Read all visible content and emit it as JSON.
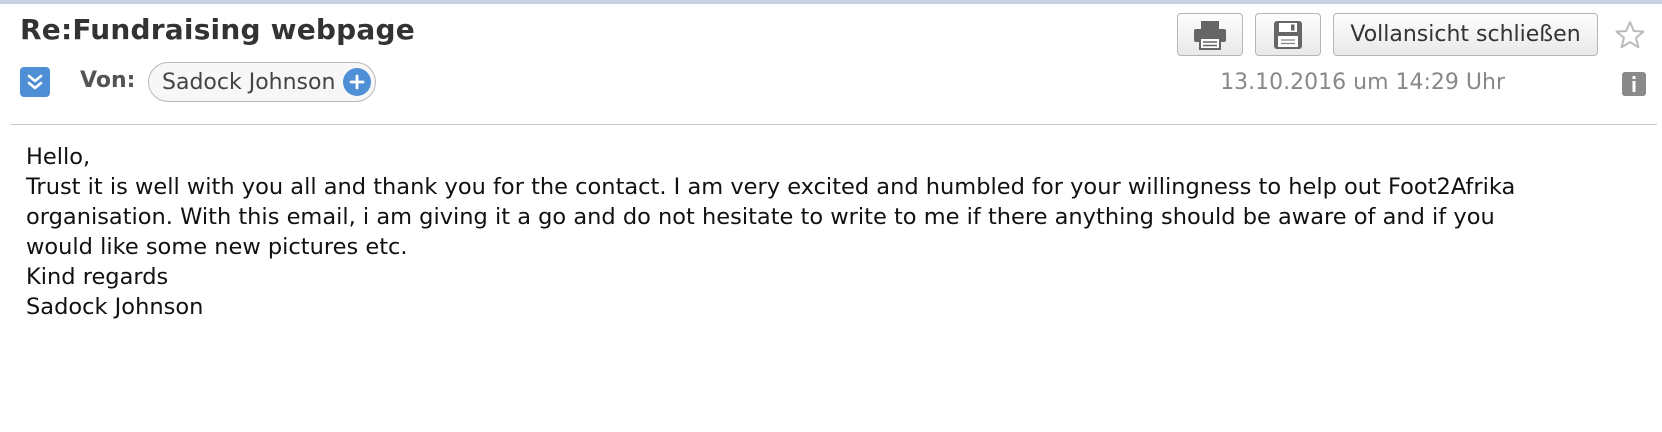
{
  "email": {
    "subject": "Re:Fundraising webpage",
    "from_label": "Von:",
    "sender": "Sadock Johnson",
    "date": "13.10.2016 um 14:29 Uhr",
    "body_lines": [
      "Hello,",
      "Trust it is well with you all and thank you for the contact. I am very excited and humbled for your willingness to help out Foot2Afrika",
      "organisation. With this email, i am giving it a go and do not hesitate to write to me if there anything should be aware of and if you",
      "would like some new pictures etc.",
      "Kind regards",
      "Sadock Johnson"
    ]
  },
  "toolbar": {
    "close_fullview_label": "Vollansicht schließen",
    "print_icon": "print-icon",
    "save_icon": "save-icon",
    "star_icon": "star-icon"
  },
  "colors": {
    "accent": "#4f8fd6",
    "top_bar": "#c7d3e3",
    "muted_text": "#888888"
  }
}
